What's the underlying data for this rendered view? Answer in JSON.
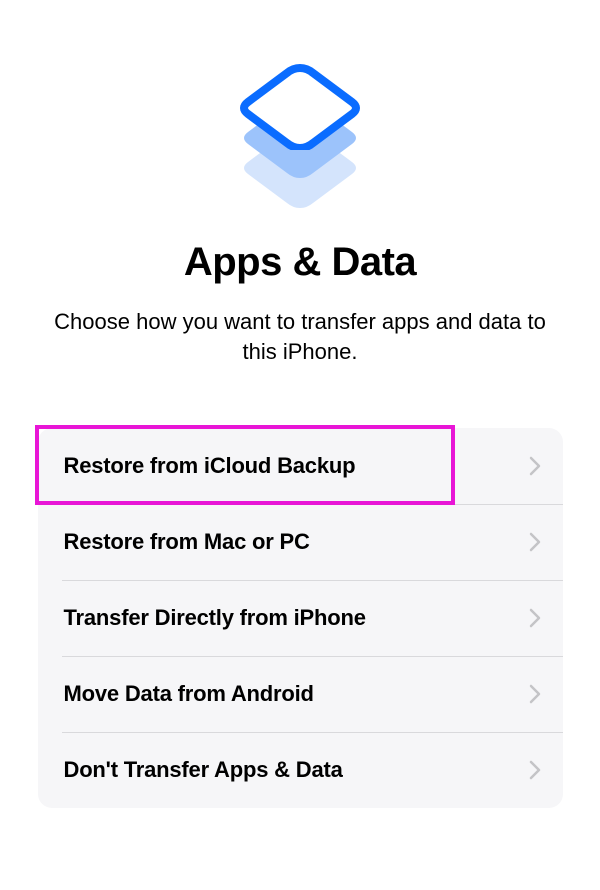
{
  "header": {
    "title": "Apps & Data",
    "subtitle": "Choose how you want to transfer apps and data to this iPhone."
  },
  "options": [
    {
      "label": "Restore from iCloud Backup",
      "highlighted": true
    },
    {
      "label": "Restore from Mac or PC"
    },
    {
      "label": "Transfer Directly from iPhone"
    },
    {
      "label": "Move Data from Android"
    },
    {
      "label": "Don't Transfer Apps & Data"
    }
  ],
  "colors": {
    "accent": "#0a6cff",
    "accent_mid": "#9cc3fb",
    "accent_light": "#d4e4fc",
    "highlight": "#e815d6",
    "chevron": "#c4c4c7",
    "card_bg": "#f6f6f8"
  }
}
